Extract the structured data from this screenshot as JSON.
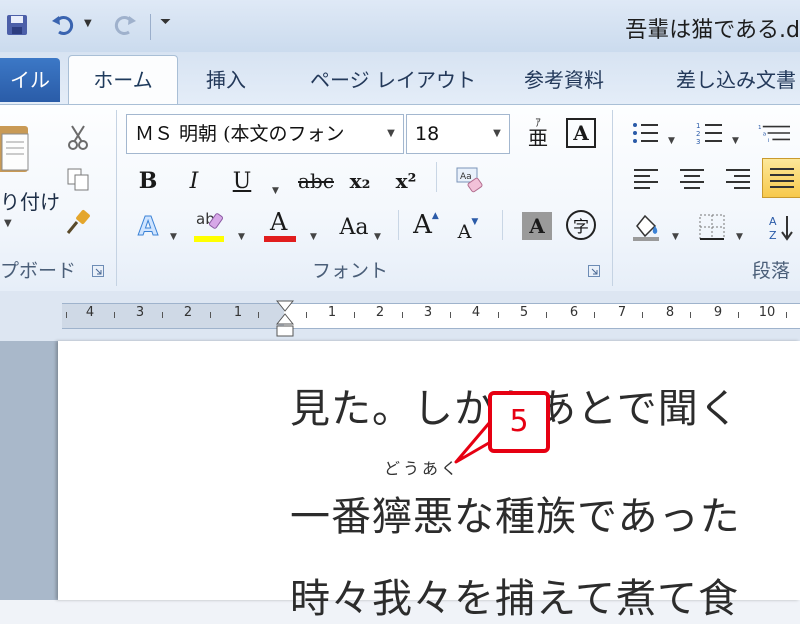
{
  "window": {
    "title": "吾輩は猫である.d"
  },
  "quick_access": {
    "icons": [
      "save-icon",
      "undo-icon",
      "redo-icon",
      "customize-icon"
    ]
  },
  "tabs": {
    "file": "イル",
    "home": "ホーム",
    "insert": "挿入",
    "page_layout": "ページ レイアウト",
    "references": "参考資料",
    "mailings": "差し込み文書"
  },
  "clipboard": {
    "paste_label": "り付け",
    "group_label": "プボード"
  },
  "font": {
    "font_name": "ＭＳ 明朝 (本文のフォン",
    "font_size": "18",
    "phonetic_guide": "亜",
    "char_border": "A",
    "bold": "B",
    "italic": "I",
    "underline": "U",
    "strike": "abc",
    "subscript": "x₂",
    "superscript": "x²",
    "clear_format": "Aa",
    "text_effects": "A",
    "highlight": "ab",
    "font_color": "A",
    "change_case": "Aa",
    "grow": "A",
    "shrink": "A",
    "char_shading": "A",
    "enclose": "字",
    "group_label": "フォント"
  },
  "paragraph": {
    "group_label": "段落"
  },
  "ruler": {
    "left_numbers": [
      "4",
      "3",
      "2",
      "1"
    ],
    "right_numbers": [
      "1",
      "2",
      "3",
      "4",
      "5",
      "6",
      "7",
      "8",
      "9",
      "10"
    ]
  },
  "document": {
    "line1": "見た。しかもあとで聞く",
    "ruby": "どうあく",
    "line2": "一番獰悪な種族であった",
    "line3": "時々我々を捕えて煮て食"
  },
  "callout": {
    "number": "5"
  },
  "colors": {
    "accent_red": "#e60012",
    "file_tab": "#2a5ca8",
    "ribbon": "#f3f7fc"
  }
}
